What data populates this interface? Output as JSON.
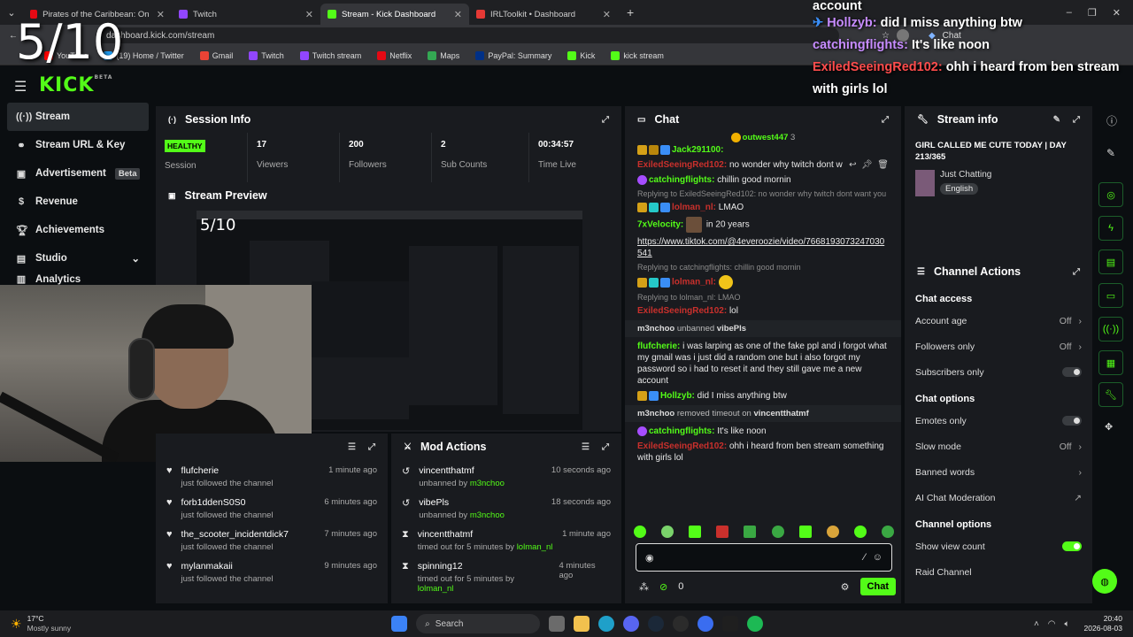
{
  "overlay_counter": "5/10",
  "browser": {
    "tabs": [
      {
        "label": "Pirates of the Caribbean: On Strang",
        "color": "#e50914"
      },
      {
        "label": "Twitch",
        "color": "#9146ff"
      },
      {
        "label": "Stream - Kick Dashboard",
        "color": "#53fc18"
      },
      {
        "label": "IRLToolkit • Dashboard",
        "color": "#e53935"
      }
    ],
    "url": "dashboard.kick.com/stream",
    "bookmarks": [
      "YouTube",
      "(19) Home / Twitter",
      "Gmail",
      "Twitch",
      "Twitch stream",
      "Netflix",
      "Maps",
      "PayPal: Summary",
      "Kick",
      "kick stream"
    ],
    "profile_label": "Chat"
  },
  "app": {
    "logo": "KICK",
    "logo_sup": "BETA"
  },
  "sidebar": {
    "items": [
      {
        "label": "Stream",
        "icon": "antenna-icon"
      },
      {
        "label": "Stream URL & Key",
        "icon": "link-icon"
      },
      {
        "label": "Advertisement",
        "icon": "ad-icon",
        "badge": "Beta"
      },
      {
        "label": "Revenue",
        "icon": "dollar-icon"
      },
      {
        "label": "Achievements",
        "icon": "trophy-icon"
      },
      {
        "label": "Studio",
        "icon": "film-icon"
      },
      {
        "label": "Analytics",
        "icon": "chart-icon"
      }
    ]
  },
  "session": {
    "title": "Session Info",
    "status": "HEALTHY",
    "status_label": "Session",
    "viewers": "17",
    "viewers_label": "Viewers",
    "followers": "200",
    "followers_label": "Followers",
    "subs": "2",
    "subs_label": "Sub Counts",
    "time": "00:34:57",
    "time_label": "Time Live"
  },
  "preview": {
    "title": "Stream Preview"
  },
  "followers_panel": {
    "rows": [
      {
        "name": "flufcherie",
        "sub": "just followed the channel",
        "time": "1 minute ago"
      },
      {
        "name": "forb1ddenS0S0",
        "sub": "just followed the channel",
        "time": "6 minutes ago"
      },
      {
        "name": "the_scooter_incidentdick7",
        "sub": "just followed the channel",
        "time": "7 minutes ago"
      },
      {
        "name": "mylanmakaii",
        "sub": "just followed the channel",
        "time": "9 minutes ago"
      }
    ]
  },
  "mod_actions": {
    "title": "Mod Actions",
    "rows": [
      {
        "name": "vincentthatmf",
        "sub": "unbanned by",
        "by": "m3nchoo",
        "time": "10 seconds ago",
        "icon": "undo-icon"
      },
      {
        "name": "vibePls",
        "sub": "unbanned by",
        "by": "m3nchoo",
        "time": "18 seconds ago",
        "icon": "undo-icon"
      },
      {
        "name": "vincentthatmf",
        "sub": "timed out for 5 minutes by",
        "by": "lolman_nl",
        "time": "1 minute ago",
        "icon": "hourglass-icon"
      },
      {
        "name": "spinning12",
        "sub": "timed out for 5 minutes by",
        "by": "lolman_nl",
        "time": "4 minutes ago",
        "icon": "hourglass-icon"
      }
    ]
  },
  "chat": {
    "title": "Chat",
    "pinned_user": "outwest447",
    "pinned_count": "3",
    "line1_user": "Jack291100:",
    "line2_user": "ExiledSeeingRed102:",
    "line2_text": "no wonder why twitch dont w",
    "line3_user": "catchingflights:",
    "line3_text": "chillin good mornin",
    "reply1": "Replying to ExiledSeeingRed102: no wonder why twitch dont want you",
    "line4_user": "lolman_nl:",
    "line4_text": "LMAO",
    "line5_user": "7xVelocity:",
    "line5_text": "in 20 years",
    "link": "https://www.tiktok.com/@4everoozie/video/7668193073247030541",
    "reply2": "Replying to catchingflights: chillin good mornin",
    "line6_user": "lolman_nl:",
    "reply3": "Replying to lolman_nl: LMAO",
    "line7_user": "ExiledSeeingRed102:",
    "line7_text": "lol",
    "sys1_user": "m3nchoo",
    "sys1_action": "unbanned",
    "sys1_target": "vibePls",
    "line8_user": "flufcherie:",
    "line8_text": "i was larping as one of the fake ppl and i forgot what my gmail was i just did a random one but i also forgot my password so i had to reset it and they still gave me a new account",
    "line9_user": "Hollzyb:",
    "line9_text": "did I miss anything btw",
    "sys2_user": "m3nchoo",
    "sys2_action": "removed timeout on",
    "sys2_target": "vincentthatmf",
    "line10_user": "catchingflights:",
    "line10_text": "It's like noon",
    "line11_user": "ExiledSeeingRed102:",
    "line11_text": "ohh i heard from ben stream something with girls lol",
    "input_value": "",
    "points": "0",
    "send_label": "Chat"
  },
  "stream_info": {
    "title": "Stream info",
    "stream_title": "GIRL CALLED ME CUTE TODAY | DAY 213/365",
    "category": "Just Chatting",
    "language": "English"
  },
  "channel_actions": {
    "title": "Channel Actions",
    "chat_access": "Chat access",
    "account_age": "Account age",
    "account_age_val": "Off",
    "followers_only": "Followers only",
    "followers_only_val": "Off",
    "subscribers_only": "Subscribers only",
    "chat_options": "Chat options",
    "emotes_only": "Emotes only",
    "slow_mode": "Slow mode",
    "slow_mode_val": "Off",
    "banned_words": "Banned words",
    "ai_moderation": "AI Chat Moderation",
    "channel_options": "Channel options",
    "show_view_count": "Show view count",
    "raid_channel": "Raid Channel"
  },
  "overlay_chat": {
    "l0": "account",
    "l1_user": "Hollzyb:",
    "l1_text": "did I miss anything btw",
    "l2_user": "catchingflights:",
    "l2_text": "It's like noon",
    "l3_user": "ExiledSeeingRed102:",
    "l3_text": "ohh i heard from ben stream",
    "l4": "with girls lol"
  },
  "taskbar": {
    "weather_temp": "17°C",
    "weather_desc": "Mostly sunny",
    "search": "Search",
    "time": "20:40",
    "date": "2026-08-03"
  }
}
